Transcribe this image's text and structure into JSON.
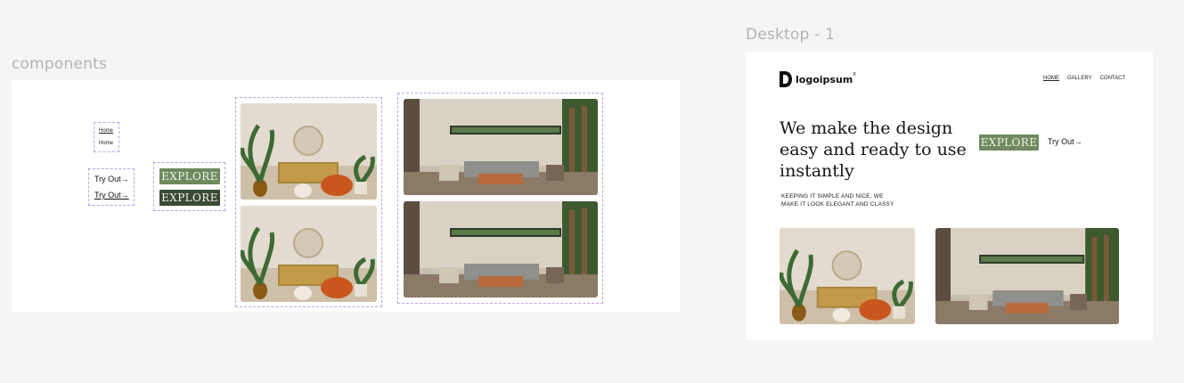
{
  "canvas": {
    "components_label": "components",
    "desktop_label": "Desktop - 1"
  },
  "components": {
    "nav_home_label": "Home",
    "nav_home_label_alt": "Home",
    "tryout_label": "Try Out",
    "tryout_arrow": "→",
    "tryout_label_hover": "Try Out",
    "explore_label": "EXPLORE",
    "explore_label_dark": "EXPLORE"
  },
  "desktop": {
    "logo_text": "logoipsum",
    "logo_mark": "®",
    "nav": [
      "HOME",
      "GALLERY",
      "CONTACT"
    ],
    "hero_title": "We make the design easy and ready to use instantly",
    "hero_sub_line1": "KEEPING IT SIMPLE AND NICE, WE",
    "hero_sub_line2": "MAKE IT LOOK ELEGANT AND CLASSY",
    "explore_label": "EXPLORE",
    "tryout_label": "Try Out",
    "tryout_arrow": "→"
  },
  "colors": {
    "accent_green": "#6e8a5e",
    "dark_green": "#3b4a34",
    "selection_dash": "#b9a6e3"
  }
}
